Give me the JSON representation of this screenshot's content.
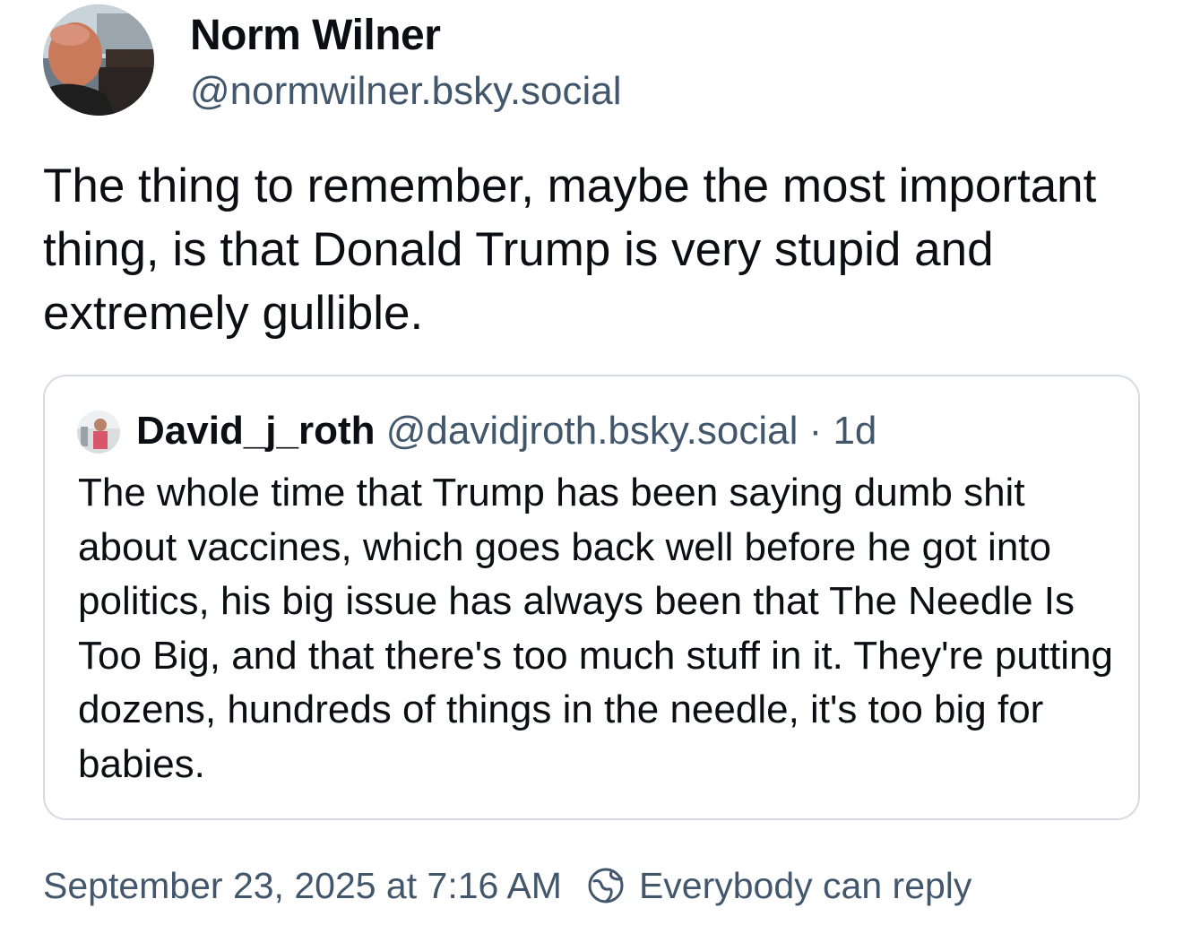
{
  "author": {
    "display_name": "Norm Wilner",
    "handle": "@normwilner.bsky.social",
    "avatar_icon": "user-avatar-photo"
  },
  "post": {
    "text": "The thing to remember, maybe the most important thing, is that Donald Trump is very stupid and extremely gullible."
  },
  "quote": {
    "display_name": "David_j_roth",
    "handle": "@davidjroth.bsky.social",
    "separator": " · ",
    "age": "1d",
    "avatar_icon": "user-avatar-photo",
    "text": "The whole time that Trump has been saying dumb shit about vaccines, which goes back well before he got into politics, his big issue has always been that The Needle Is Too Big, and that there's too much stuff in it. They're putting dozens, hundreds of things in the needle, it's too big for babies."
  },
  "footer": {
    "timestamp": "September 23, 2025 at 7:16 AM",
    "reply_setting": "Everybody can reply",
    "reply_icon": "globe-reply-icon"
  },
  "colors": {
    "text_primary": "#0b0f14",
    "text_secondary": "#42576c",
    "card_border": "#d4dbe2"
  }
}
